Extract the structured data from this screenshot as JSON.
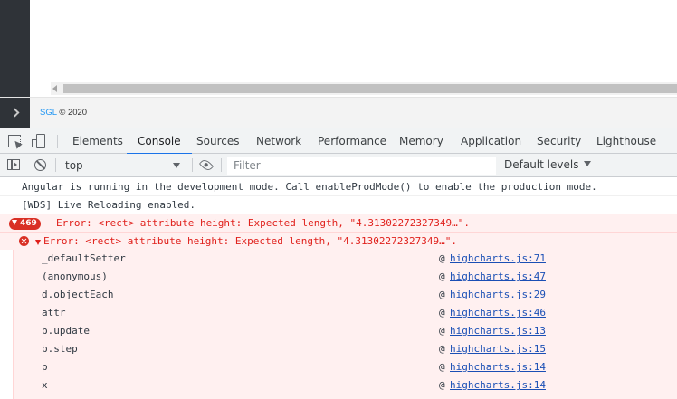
{
  "app": {
    "footer": {
      "brand": "SGL",
      "copyright": "© 2020"
    }
  },
  "devtools": {
    "tabs": [
      {
        "label": "Elements",
        "active": false
      },
      {
        "label": "Console",
        "active": true
      },
      {
        "label": "Sources",
        "active": false
      },
      {
        "label": "Network",
        "active": false
      },
      {
        "label": "Performance",
        "active": false
      },
      {
        "label": "Memory",
        "active": false
      },
      {
        "label": "Application",
        "active": false
      },
      {
        "label": "Security",
        "active": false
      },
      {
        "label": "Lighthouse",
        "active": false
      }
    ],
    "toolbar": {
      "context": "top",
      "filter_placeholder": "Filter",
      "levels": "Default levels"
    }
  },
  "console": {
    "messages": [
      {
        "text": "Angular is running in the development mode. Call enableProdMode() to enable the production mode."
      },
      {
        "text": "[WDS] Live Reloading enabled."
      }
    ],
    "error_group": {
      "count": "469",
      "text": "Error: <rect> attribute height: Expected length, \"4.31302272327349…\"."
    },
    "error_expanded": {
      "text": "Error: <rect> attribute height: Expected length, \"4.31302272327349…\".",
      "stack": [
        {
          "fn": "_defaultSetter",
          "src": "highcharts.js:71"
        },
        {
          "fn": "(anonymous)",
          "src": "highcharts.js:47"
        },
        {
          "fn": "d.objectEach",
          "src": "highcharts.js:29"
        },
        {
          "fn": "attr",
          "src": "highcharts.js:46"
        },
        {
          "fn": "b.update",
          "src": "highcharts.js:13"
        },
        {
          "fn": "b.step",
          "src": "highcharts.js:15"
        },
        {
          "fn": "p",
          "src": "highcharts.js:14"
        },
        {
          "fn": "x",
          "src": "highcharts.js:14"
        }
      ],
      "at_symbol": "@"
    }
  },
  "colors": {
    "accent": "#1a73e8",
    "error": "#e0211c",
    "error_bg": "#fff0f0",
    "link": "#1a4fb5",
    "sidebar": "#2f3338"
  }
}
